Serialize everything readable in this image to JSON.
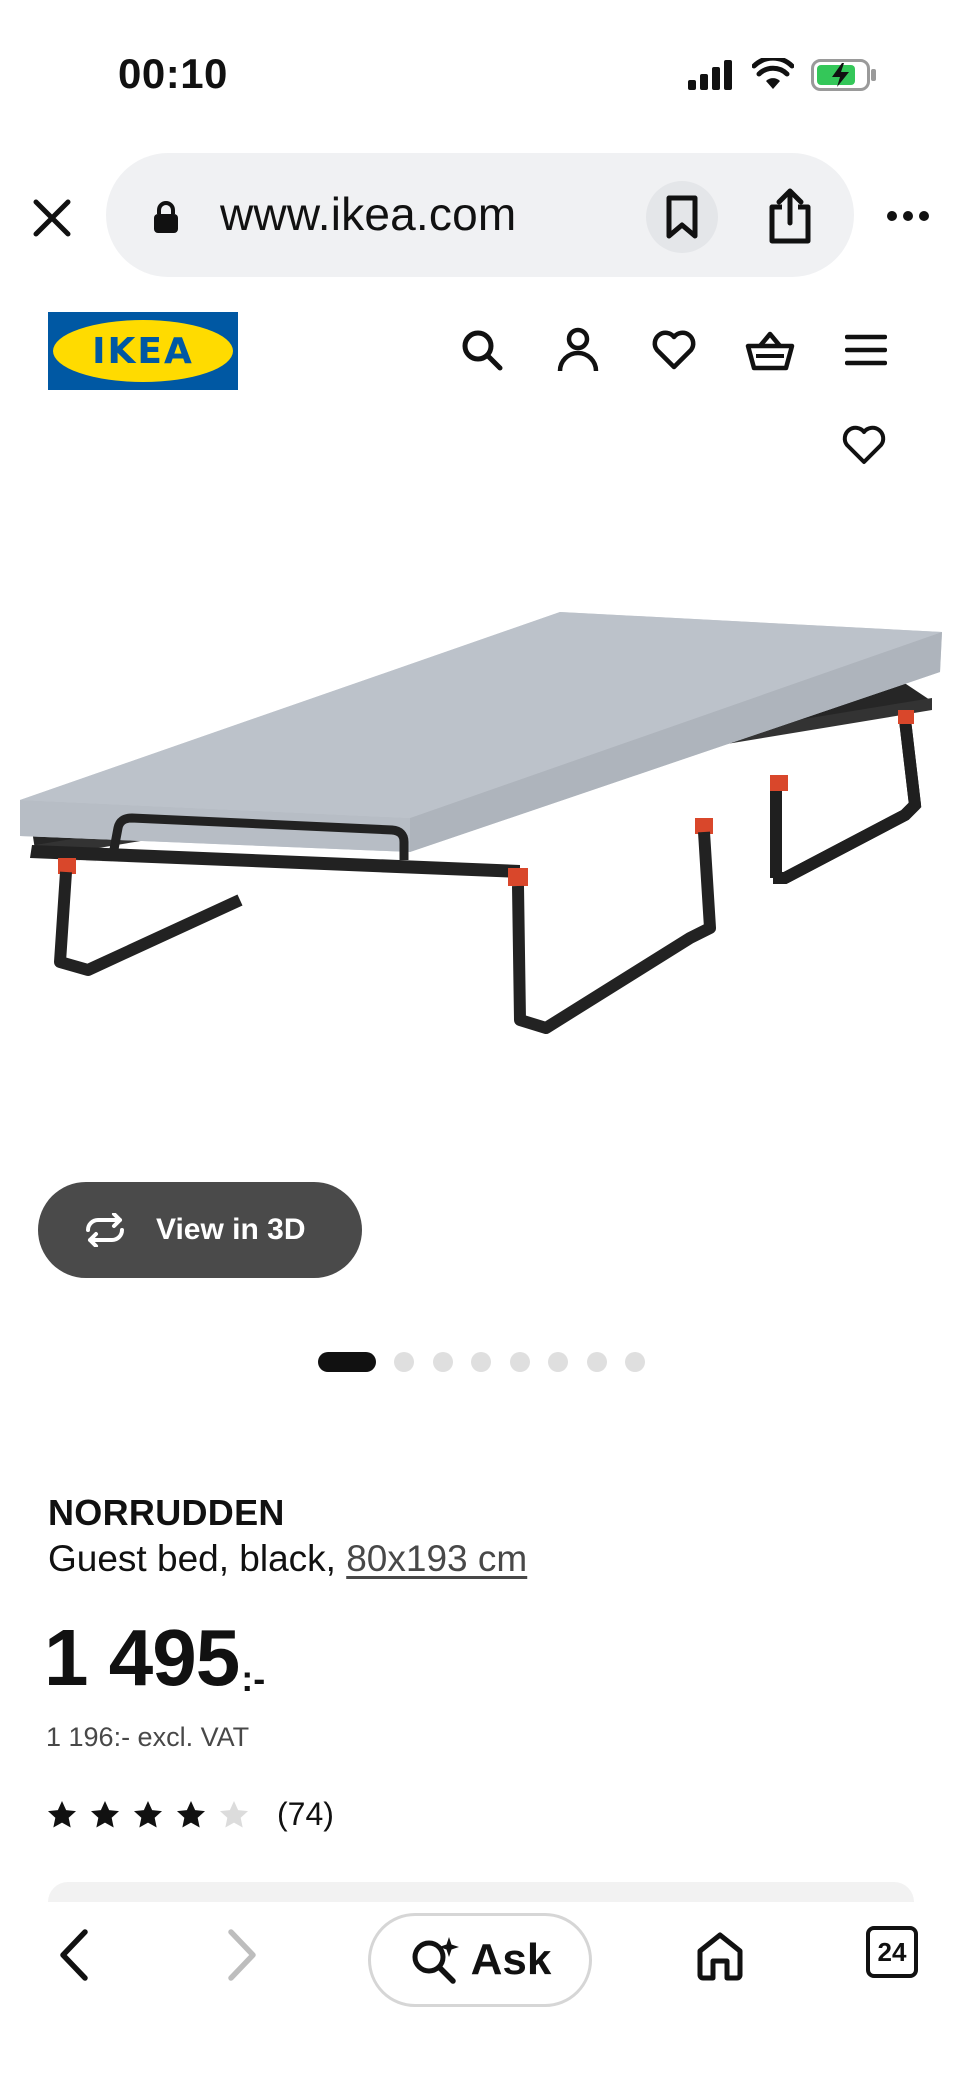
{
  "status_bar": {
    "time": "00:10",
    "icons": [
      "cellular-signal-icon",
      "wifi-icon",
      "battery-charging-icon"
    ],
    "battery_color": "#34c759"
  },
  "browser": {
    "url": "www.ikea.com",
    "icons": [
      "close-icon",
      "lock-icon",
      "bookmark-icon",
      "share-icon",
      "more-icon"
    ]
  },
  "header": {
    "logo_text": "IKEA",
    "logo_colors": {
      "blue": "#0058a3",
      "yellow": "#ffdb00"
    },
    "icons": [
      "search-icon",
      "account-icon",
      "heart-icon",
      "basket-icon",
      "menu-icon"
    ]
  },
  "gallery": {
    "view_3d_label": "View in 3D",
    "image_count": 8,
    "active_index": 0
  },
  "product": {
    "name": "NORRUDDEN",
    "description": "Guest bed, black,",
    "size": "80x193 cm",
    "price": "1 495",
    "price_suffix": ":-",
    "price_excl_vat": "1 196:- excl. VAT",
    "rating": 4,
    "rating_max": 5,
    "review_count": "(74)"
  },
  "toolbar": {
    "ask_label": "Ask",
    "tab_count": "24",
    "icons": [
      "back-icon",
      "forward-icon",
      "ask-sparkle-search-icon",
      "home-icon",
      "tabs-icon"
    ]
  }
}
